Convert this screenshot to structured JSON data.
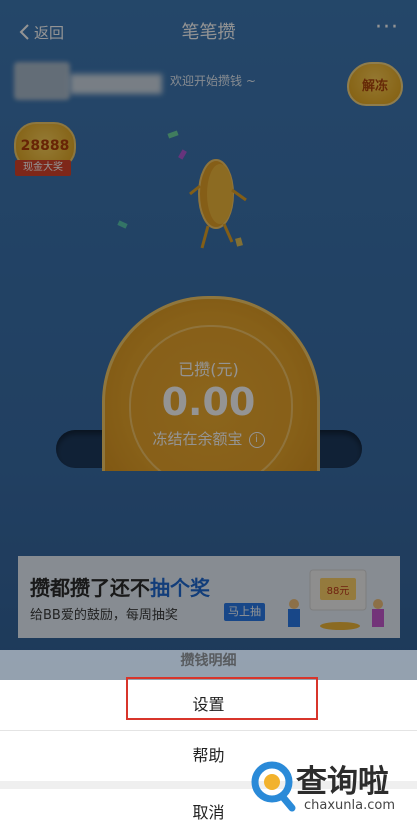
{
  "header": {
    "back_label": "返回",
    "title": "笔笔攒",
    "more_label": "···"
  },
  "user": {
    "welcome_text": "欢迎开始攒钱 ~",
    "unfreeze_label": "解冻"
  },
  "prize_badge": {
    "amount": "28888",
    "label": "现金大奖"
  },
  "coin": {
    "saved_label": "已攒(元)",
    "amount": "0.00",
    "frozen_text": "冻结在余额宝"
  },
  "banner": {
    "title_prefix": "攒都攒了还不",
    "title_highlight": "抽个奖",
    "subtitle": "给BB爱的鼓励，每周抽奖",
    "button_label": "马上抽",
    "art_amount": "88元"
  },
  "background_text": "攒钱明细",
  "action_sheet": {
    "items": [
      "设置",
      "帮助",
      "取消"
    ]
  },
  "watermark": {
    "brand_cn": "查询啦",
    "brand_en": "chaxunla.com"
  },
  "colors": {
    "background": "#3c73ad",
    "coin_gold": "#e8a52a",
    "highlight_red": "#d8352b",
    "link_blue": "#1f6ad3"
  }
}
